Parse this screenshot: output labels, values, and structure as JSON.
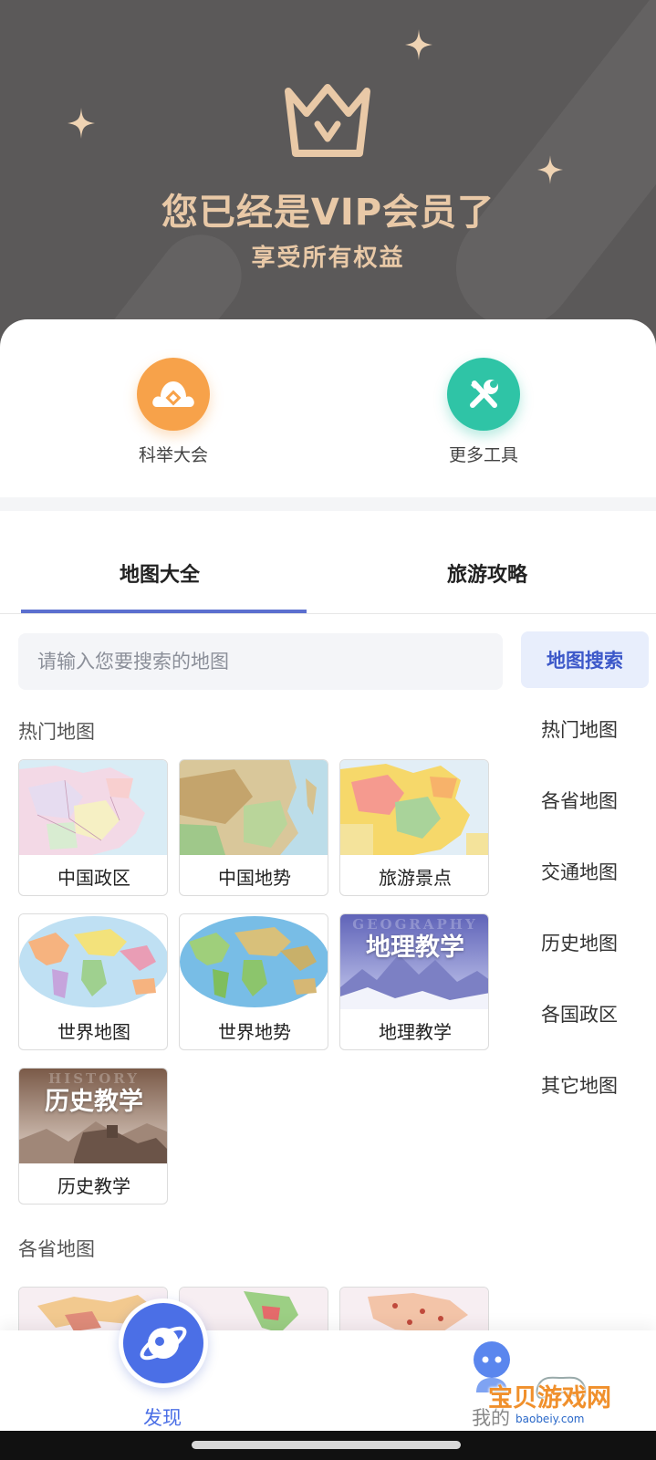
{
  "colors": {
    "hero_bg": "#5b5959",
    "gold": "#e9c9a7",
    "accent_blue": "#4b6fe6",
    "tab_indicator": "#5b6fcf",
    "orange_icon": "#f7a24a",
    "green_icon": "#2fc4a6"
  },
  "hero": {
    "title": "您已经是VIP会员了",
    "subtitle": "享受所有权益",
    "icon": "crown-icon"
  },
  "tools": [
    {
      "label": "科举大会",
      "icon": "exam-icon"
    },
    {
      "label": "更多工具",
      "icon": "tools-icon"
    }
  ],
  "tabs": [
    {
      "label": "地图大全",
      "active": true
    },
    {
      "label": "旅游攻略",
      "active": false
    }
  ],
  "search": {
    "placeholder": "请输入您要搜索的地图",
    "button": "地图搜索"
  },
  "sections": {
    "hot": "热门地图",
    "provinces": "各省地图"
  },
  "maps": [
    {
      "name": "中国政区"
    },
    {
      "name": "中国地势"
    },
    {
      "name": "旅游景点"
    },
    {
      "name": "世界地图"
    },
    {
      "name": "世界地势"
    },
    {
      "name": "地理教学",
      "thumb_title": "地理教学",
      "thumb_ghost": "GEOGRAPHY"
    },
    {
      "name": "历史教学",
      "thumb_title": "历史教学",
      "thumb_ghost": "HISTORY"
    }
  ],
  "side_nav": [
    "热门地图",
    "各省地图",
    "交通地图",
    "历史地图",
    "各国政区",
    "其它地图"
  ],
  "bottom_nav": {
    "discover": "发现",
    "mine": "我的"
  },
  "watermark": {
    "text": "宝贝游戏网",
    "url": "baobeiy.com"
  }
}
